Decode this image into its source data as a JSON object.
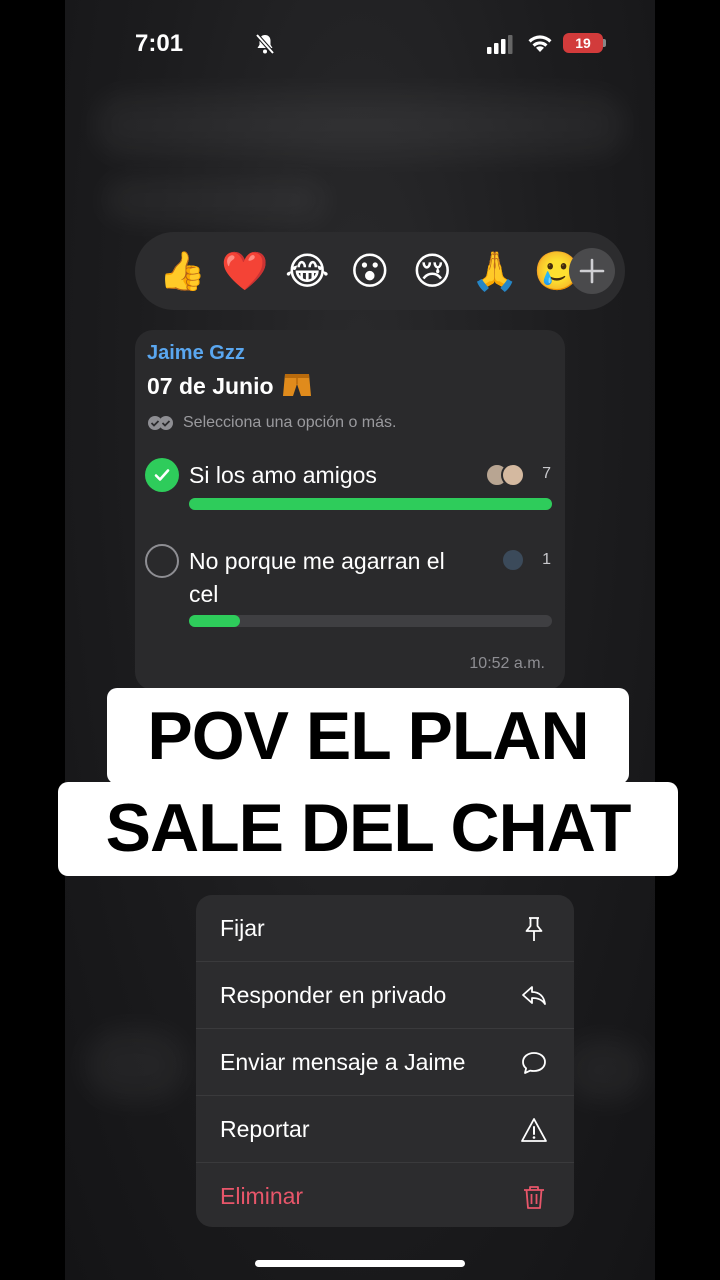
{
  "status_bar": {
    "time": "7:01",
    "battery": "19"
  },
  "reactions": {
    "emojis": [
      "👍",
      "❤️",
      "😂",
      "😮",
      "😢",
      "🙏",
      "🥲"
    ],
    "add_icon": "plus-icon"
  },
  "message": {
    "sender": "Jaime Gzz",
    "title": "07 de Junio",
    "title_icon": "shorts-emoji-icon",
    "hint": "Selecciona una opción o más.",
    "options": [
      {
        "label": "Si los amo amigos",
        "votes": "7",
        "checked": true,
        "fill_fraction": 1.0
      },
      {
        "label": "No porque me agarran el cel",
        "votes": "1",
        "checked": false,
        "fill_fraction": 0.14
      }
    ],
    "time": "10:52 a.m.",
    "colors": {
      "sender": "#5aa7f0",
      "accent": "#2ecc5b"
    }
  },
  "caption": {
    "line1": "POV EL PLAN",
    "line2": "SALE DEL CHAT"
  },
  "menu": {
    "items": [
      {
        "label": "Fijar",
        "icon": "pin-icon"
      },
      {
        "label": "Responder en privado",
        "icon": "reply-icon"
      },
      {
        "label": "Enviar mensaje a Jaime",
        "icon": "chat-bubble-icon"
      },
      {
        "label": "Reportar",
        "icon": "warning-icon"
      },
      {
        "label": "Eliminar",
        "icon": "trash-icon"
      }
    ],
    "danger_color": "#e8566a"
  }
}
